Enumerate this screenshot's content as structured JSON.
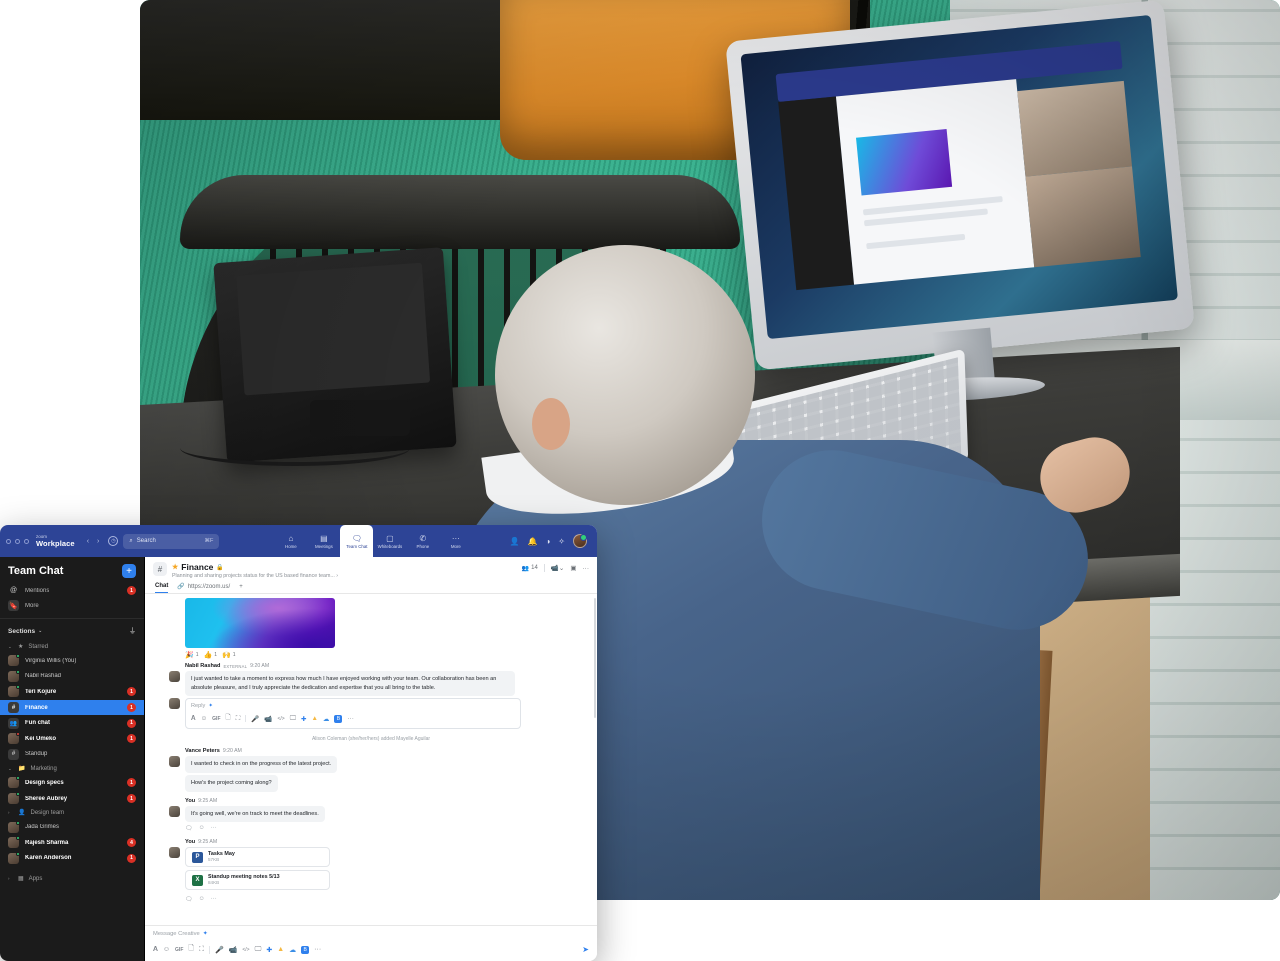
{
  "scene": {
    "description": "Photo of a man seated at a dark wood desk using an iMac running Zoom Workplace Team Chat with a video meeting, green carpet, orange bench cushion, windows at right"
  },
  "app": {
    "topbar": {
      "brand_small": "zoom",
      "brand_large": "Workplace",
      "back_icon": "chevron-left-icon",
      "forward_icon": "chevron-right-icon",
      "history_icon": "clock-icon",
      "search_placeholder": "Search",
      "search_shortcut": "⌘F",
      "nav_items": [
        {
          "label": "Home",
          "icon": "home-icon",
          "active": false
        },
        {
          "label": "Meetings",
          "icon": "calendar-icon",
          "active": false
        },
        {
          "label": "Team Chat",
          "icon": "chat-icon",
          "active": true
        },
        {
          "label": "Whiteboards",
          "icon": "whiteboard-icon",
          "active": false
        },
        {
          "label": "Phone",
          "icon": "phone-icon",
          "active": false
        },
        {
          "label": "More",
          "icon": "more-icon",
          "active": false
        }
      ],
      "right_icons": [
        "contacts-icon",
        "bell-icon",
        "theme-icon",
        "sparkle-ai-icon"
      ],
      "avatar": "user-avatar"
    },
    "sidebar": {
      "title": "Team Chat",
      "add_label": "+",
      "quick": [
        {
          "label": "Mentions",
          "icon": "at-icon",
          "badge": "1"
        },
        {
          "label": "More",
          "icon": "bookmark-icon",
          "badge": ""
        }
      ],
      "sections_label": "Sections",
      "filter_icon": "filter-icon",
      "groups": [
        {
          "label": "Starred",
          "icon": "star-icon",
          "expanded": true,
          "items": [
            {
              "name": "Virginia Willis (You)",
              "badge": "",
              "unread": false,
              "presence": "on",
              "type": "person"
            },
            {
              "name": "Nabil Rashad",
              "badge": "",
              "unread": false,
              "presence": "on",
              "type": "person"
            },
            {
              "name": "Teri Kojure",
              "badge": "1",
              "unread": true,
              "presence": "on",
              "type": "person"
            },
            {
              "name": "Finance",
              "badge": "1",
              "unread": true,
              "selected": true,
              "presence": "",
              "type": "channel"
            },
            {
              "name": "Fun chat",
              "badge": "1",
              "unread": true,
              "presence": "",
              "type": "group"
            },
            {
              "name": "Kei Umeko",
              "badge": "1",
              "unread": true,
              "presence": "busy",
              "type": "person"
            },
            {
              "name": "Standup",
              "badge": "",
              "unread": false,
              "presence": "",
              "type": "channel"
            }
          ]
        },
        {
          "label": "Marketing",
          "icon": "folder-icon",
          "expanded": true,
          "items": [
            {
              "name": "Design specs",
              "badge": "1",
              "unread": true,
              "presence": "on",
              "type": "person"
            },
            {
              "name": "Sheree Aubrey",
              "badge": "1",
              "unread": true,
              "presence": "on",
              "type": "person"
            }
          ]
        },
        {
          "label": "Design team",
          "icon": "team-icon",
          "expanded": false,
          "items": [
            {
              "name": "Jada Grimes",
              "badge": "",
              "unread": false,
              "presence": "on",
              "type": "person"
            },
            {
              "name": "Rajesh Sharma",
              "badge": "4",
              "unread": true,
              "presence": "on",
              "type": "person"
            },
            {
              "name": "Karen Anderson",
              "badge": "1",
              "unread": true,
              "presence": "on",
              "type": "person"
            }
          ]
        },
        {
          "label": "Apps",
          "icon": "apps-icon",
          "expanded": false,
          "items": []
        }
      ]
    },
    "channel": {
      "hash_icon": "hash-icon",
      "star_icon": "star-filled-icon",
      "lock_icon": "lock-icon",
      "name": "Finance",
      "description": "Planning and sharing projects status for the US based finance team... ›",
      "member_count": "14",
      "member_icon": "people-icon",
      "video_icon": "video-camera-icon",
      "panel_icon": "panel-icon",
      "more_icon": "ellipsis-icon",
      "tabs": [
        {
          "label": "Chat",
          "active": true,
          "icon": ""
        },
        {
          "label": "https://zoom.us/",
          "active": false,
          "icon": "link-icon"
        }
      ],
      "add_tab": "+"
    },
    "messages": {
      "image_attachment": "gradient-wave-image",
      "reactions": [
        {
          "emoji": "🎉",
          "count": "1"
        },
        {
          "emoji": "👍",
          "count": "1"
        },
        {
          "emoji": "🙌",
          "count": "1"
        }
      ],
      "items": [
        {
          "author": "Nabil Rashad",
          "tag": "EXTERNAL",
          "time": "9:20 AM",
          "bubbles": [
            "I just wanted to take a moment to express how much I have enjoyed working with your team. Our collaboration has been an absolute pleasure, and I truly appreciate the dedication and expertise that you all bring to the table."
          ]
        },
        {
          "author": "Vance Peters",
          "tag": "",
          "time": "9:20 AM",
          "bubbles": [
            "I wanted to check in on the progress of the latest project.",
            "How's the project coming along?"
          ]
        },
        {
          "author": "You",
          "tag": "",
          "time": "9:25 AM",
          "bubbles": [
            "It's going well, we're on track to meet the deadlines."
          ]
        }
      ],
      "reply_placeholder": "Reply",
      "system_message": "Alison Coleman (she/her/hers) added Mayelle Aguilar",
      "files_message": {
        "author": "You",
        "time": "9:25 AM",
        "files": [
          {
            "name": "Tasks May",
            "size": "57KB",
            "icon": "powerpoint-icon",
            "color": "blue"
          },
          {
            "name": "Standup meeting notes 5/13",
            "size": "84KB",
            "icon": "excel-icon",
            "color": "green"
          }
        ]
      },
      "message_actions": [
        "reply-icon",
        "emoji-icon",
        "ellipsis-icon"
      ]
    },
    "composer": {
      "placeholder": "Message Creative",
      "ai_icon": "ai-sparkle-icon",
      "tools": [
        "format-icon",
        "emoji-icon",
        "gif-icon",
        "file-icon",
        "screenshot-icon",
        "audio-icon",
        "video-icon",
        "code-icon",
        "screenshare-icon",
        "zoom-app-icon",
        "drive-icon",
        "onedrive-icon",
        "box-icon",
        "more-icon"
      ],
      "send_icon": "send-icon"
    }
  },
  "colors": {
    "nav_blue": "#2d4496",
    "accent_blue": "#2f80ed",
    "badge_red": "#d93025",
    "sidebar_bg": "#1b1b1b",
    "star_gold": "#f5a623"
  }
}
